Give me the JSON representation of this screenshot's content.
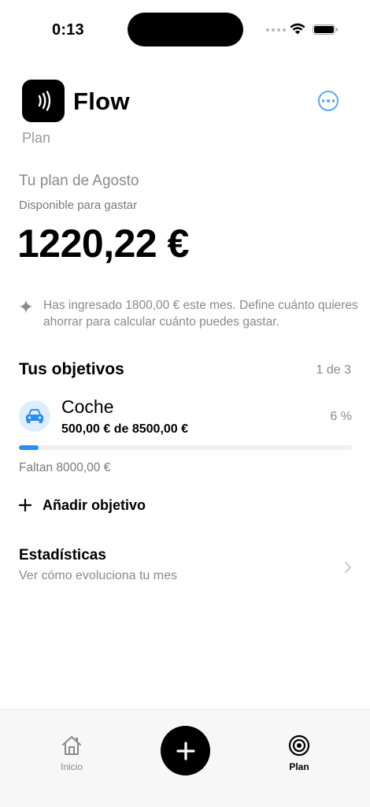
{
  "status_bar": {
    "time": "0:13"
  },
  "header": {
    "app_name": "Flow",
    "subtitle": "Plan",
    "more_icon": "ellipsis-circle-icon",
    "logo_icon": "sound-waves-icon"
  },
  "plan": {
    "title": "Tu plan de Agosto",
    "available_label": "Disponible para gastar",
    "available_amount": "1220,22 €",
    "note": "Has ingresado 1800,00 € este mes. Define cuánto quieres ahorrar para calcular cuánto puedes gastar.",
    "note_icon": "sparkle-icon"
  },
  "goals": {
    "heading": "Tus objetivos",
    "count": "1 de 3",
    "items": [
      {
        "name": "Coche",
        "progress_text": "500,00 € de 8500,00 €",
        "percent_label": "6 %",
        "progress_fraction": 0.06,
        "remaining": "Faltan 8000,00 €",
        "icon": "car-icon"
      }
    ],
    "add_label": "Añadir objetivo"
  },
  "stats": {
    "title": "Estadísticas",
    "subtitle": "Ver cómo evoluciona tu mes"
  },
  "tab_bar": {
    "home_label": "Inicio",
    "plan_label": "Plan",
    "add_icon": "plus-icon"
  },
  "colors": {
    "accent": "#2d8cf0",
    "accent_light": "#ddeeff",
    "muted": "#8a8a8a"
  }
}
